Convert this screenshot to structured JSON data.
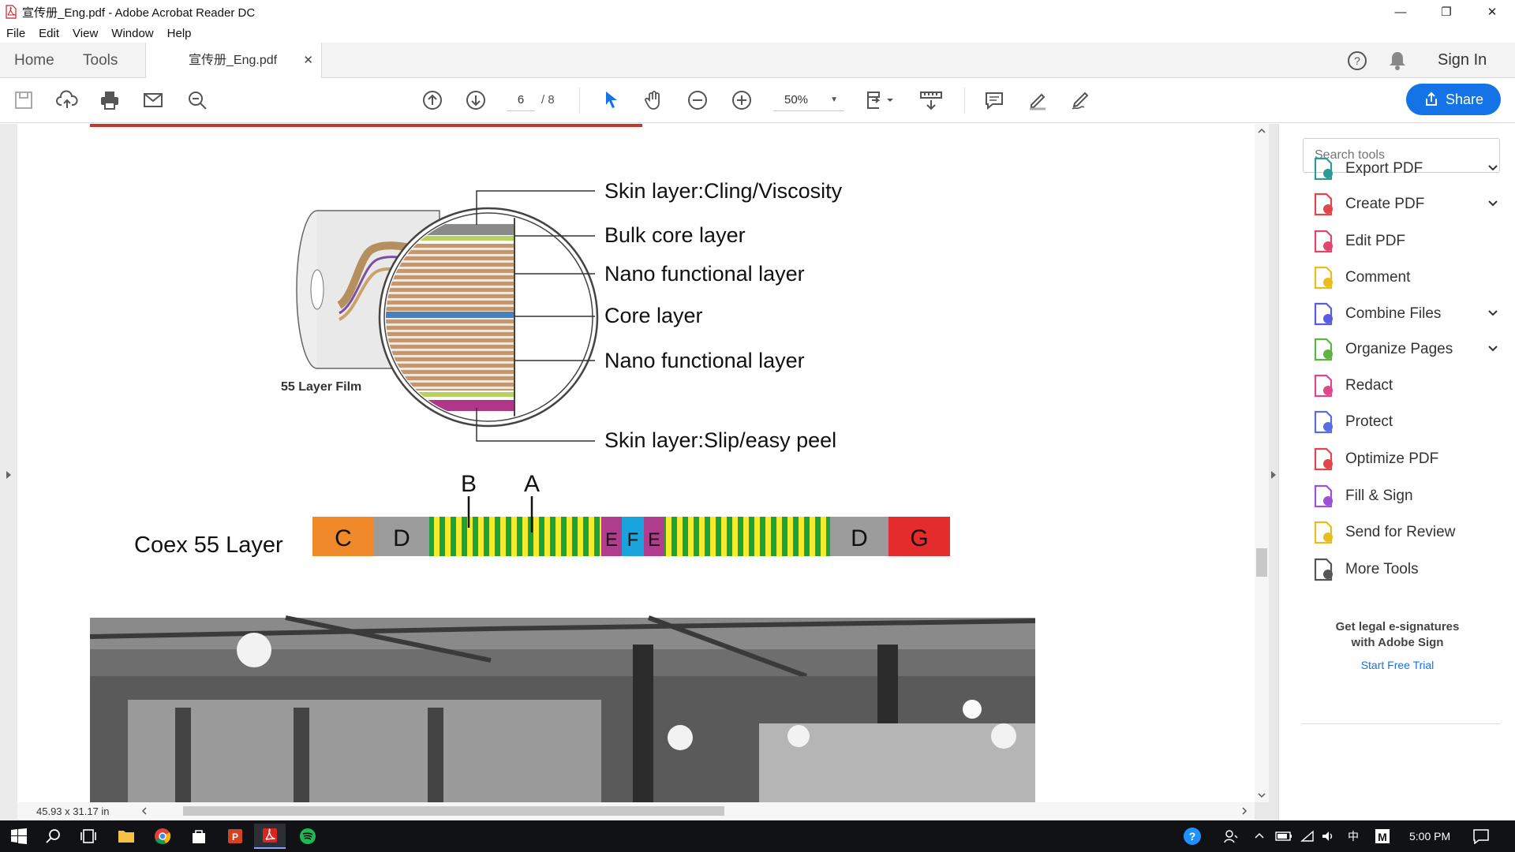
{
  "window": {
    "title": "宣传册_Eng.pdf - Adobe Acrobat Reader DC",
    "controls": [
      "minimize",
      "restore",
      "close"
    ]
  },
  "menu": [
    "File",
    "Edit",
    "View",
    "Window",
    "Help"
  ],
  "tabs": {
    "home": "Home",
    "tools": "Tools",
    "document": "宣传册_Eng.pdf",
    "sign_in": "Sign In"
  },
  "toolbar": {
    "page_current": "6",
    "page_total": "/ 8",
    "zoom": "50%",
    "share": "Share"
  },
  "document": {
    "callouts": [
      "Skin layer:Cling/Viscosity",
      "Bulk core layer",
      "Nano functional layer",
      "Core layer",
      "Nano functional layer",
      "Skin layer:Slip/easy peel"
    ],
    "film_label": "55 Layer Film",
    "coex_label": "Coex 55 Layer",
    "markers": [
      "B",
      "A"
    ],
    "segments": [
      "C",
      "D",
      "E",
      "F",
      "E",
      "D",
      "G"
    ],
    "dimensions": "45.93 x 31.17 in"
  },
  "panel": {
    "search_placeholder": "Search tools",
    "tools": [
      {
        "label": "Export PDF",
        "color": "#2d9b94",
        "icon": "export-pdf-icon",
        "expandable": true
      },
      {
        "label": "Create PDF",
        "color": "#e0464b",
        "icon": "create-pdf-icon",
        "expandable": true
      },
      {
        "label": "Edit PDF",
        "color": "#e0466e",
        "icon": "edit-pdf-icon",
        "expandable": false
      },
      {
        "label": "Comment",
        "color": "#e9bd1f",
        "icon": "comment-icon",
        "expandable": false
      },
      {
        "label": "Combine Files",
        "color": "#5b5be0",
        "icon": "combine-files-icon",
        "expandable": true
      },
      {
        "label": "Organize Pages",
        "color": "#5fb244",
        "icon": "organize-pages-icon",
        "expandable": true
      },
      {
        "label": "Redact",
        "color": "#e0468a",
        "icon": "redact-icon",
        "expandable": false
      },
      {
        "label": "Protect",
        "color": "#5b6be0",
        "icon": "protect-icon",
        "expandable": false
      },
      {
        "label": "Optimize PDF",
        "color": "#e0464b",
        "icon": "optimize-pdf-icon",
        "expandable": false
      },
      {
        "label": "Fill & Sign",
        "color": "#9b52d8",
        "icon": "fill-sign-icon",
        "expandable": false
      },
      {
        "label": "Send for Review",
        "color": "#e9bd1f",
        "icon": "send-review-icon",
        "expandable": false
      },
      {
        "label": "More Tools",
        "color": "#555555",
        "icon": "more-tools-icon",
        "expandable": false
      }
    ],
    "promo_line1": "Get legal e-signatures",
    "promo_line2": "with Adobe Sign",
    "promo_link": "Start Free Trial"
  },
  "taskbar": {
    "ime": "中",
    "time": "5:00 PM"
  }
}
